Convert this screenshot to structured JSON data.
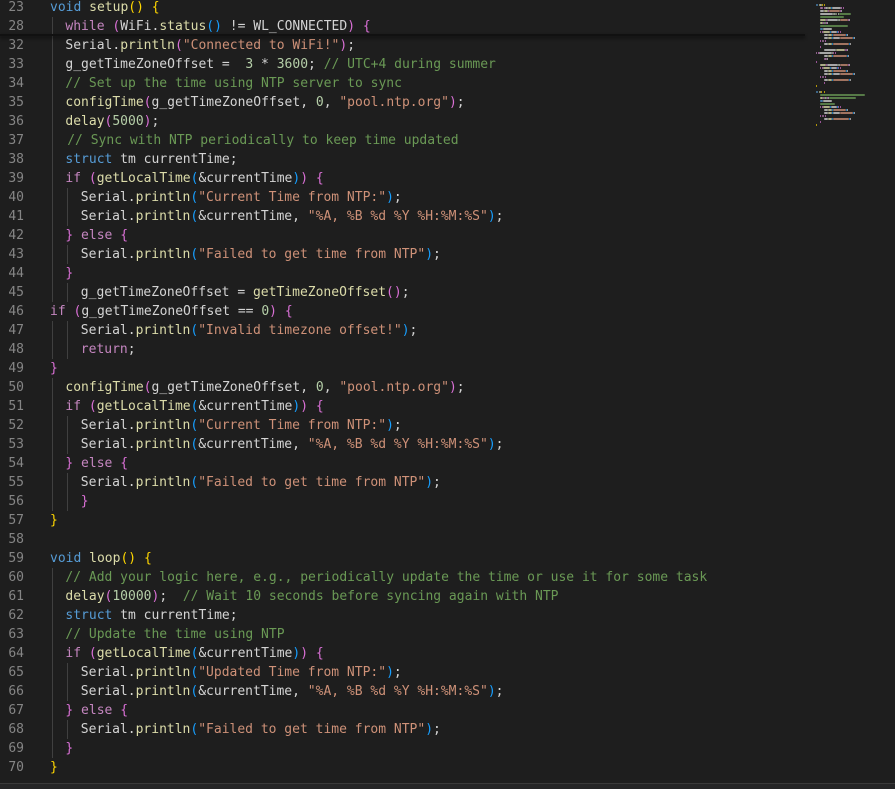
{
  "colors": {
    "background": "#1e1e1e",
    "line_number": "#858585",
    "keyword": "#569cd6",
    "control": "#c586c0",
    "function": "#dcdcaa",
    "string": "#ce9178",
    "number": "#b5cea8",
    "comment": "#6a9955",
    "plain": "#d4d4d4",
    "bracket_1": "#ffd700",
    "bracket_2": "#da70d6",
    "bracket_3": "#179fff"
  },
  "editor": {
    "lines": [
      {
        "n": "23",
        "indent": 0,
        "tokens": [
          [
            "kw",
            "void"
          ],
          [
            "plain",
            " "
          ],
          [
            "fn",
            "setup"
          ],
          [
            "br1",
            "()"
          ],
          [
            "plain",
            " "
          ],
          [
            "br1",
            "{"
          ]
        ]
      },
      {
        "n": "28",
        "indent": 1,
        "tokens": [
          [
            "ctrl",
            "while"
          ],
          [
            "plain",
            " "
          ],
          [
            "br2",
            "("
          ],
          [
            "plain",
            "WiFi."
          ],
          [
            "fn",
            "status"
          ],
          [
            "br3",
            "()"
          ],
          [
            "plain",
            " != WL_CONNECTED"
          ],
          [
            "br2",
            ")"
          ],
          [
            "plain",
            " "
          ],
          [
            "br2",
            "{"
          ]
        ]
      },
      {
        "n": "32",
        "indent": 1,
        "tokens": [
          [
            "plain",
            "Serial."
          ],
          [
            "fn",
            "println"
          ],
          [
            "br2",
            "("
          ],
          [
            "str",
            "\"Connected to WiFi!\""
          ],
          [
            "br2",
            ")"
          ],
          [
            "plain",
            ";"
          ]
        ]
      },
      {
        "n": "33",
        "indent": 1,
        "tokens": [
          [
            "plain",
            "g_getTimeZoneOffset =  "
          ],
          [
            "num",
            "3"
          ],
          [
            "plain",
            " * "
          ],
          [
            "num",
            "3600"
          ],
          [
            "plain",
            "; "
          ],
          [
            "cm",
            "// UTC+4 during summer"
          ]
        ]
      },
      {
        "n": "34",
        "indent": 1,
        "tokens": [
          [
            "cm",
            "// Set up the time using NTP server to sync"
          ]
        ]
      },
      {
        "n": "35",
        "indent": 1,
        "tokens": [
          [
            "fn",
            "configTime"
          ],
          [
            "br2",
            "("
          ],
          [
            "plain",
            "g_getTimeZoneOffset, "
          ],
          [
            "num",
            "0"
          ],
          [
            "plain",
            ", "
          ],
          [
            "str",
            "\"pool.ntp.org\""
          ],
          [
            "br2",
            ")"
          ],
          [
            "plain",
            ";"
          ]
        ]
      },
      {
        "n": "36",
        "indent": 1,
        "tokens": [
          [
            "fn",
            "delay"
          ],
          [
            "br2",
            "("
          ],
          [
            "num",
            "5000"
          ],
          [
            "br2",
            ")"
          ],
          [
            "plain",
            ";"
          ]
        ]
      },
      {
        "n": "37",
        "indent": 1.12,
        "tokens": [
          [
            "cm",
            "// Sync with NTP periodically to keep time updated"
          ]
        ]
      },
      {
        "n": "38",
        "indent": 1,
        "tokens": [
          [
            "kw",
            "struct"
          ],
          [
            "plain",
            " tm currentTime;"
          ]
        ]
      },
      {
        "n": "39",
        "indent": 1,
        "tokens": [
          [
            "ctrl",
            "if"
          ],
          [
            "plain",
            " "
          ],
          [
            "br2",
            "("
          ],
          [
            "fn",
            "getLocalTime"
          ],
          [
            "br3",
            "("
          ],
          [
            "plain",
            "&currentTime"
          ],
          [
            "br3",
            ")"
          ],
          [
            "br2",
            ")"
          ],
          [
            "plain",
            " "
          ],
          [
            "br2",
            "{"
          ]
        ]
      },
      {
        "n": "40",
        "indent": 2,
        "tokens": [
          [
            "plain",
            "Serial."
          ],
          [
            "fn",
            "println"
          ],
          [
            "br3",
            "("
          ],
          [
            "str",
            "\"Current Time from NTP:\""
          ],
          [
            "br3",
            ")"
          ],
          [
            "plain",
            ";"
          ]
        ]
      },
      {
        "n": "41",
        "indent": 2,
        "tokens": [
          [
            "plain",
            "Serial."
          ],
          [
            "fn",
            "println"
          ],
          [
            "br3",
            "("
          ],
          [
            "plain",
            "&currentTime, "
          ],
          [
            "str",
            "\"%A, %B %d %Y %H:%M:%S\""
          ],
          [
            "br3",
            ")"
          ],
          [
            "plain",
            ";"
          ]
        ]
      },
      {
        "n": "42",
        "indent": 1,
        "tokens": [
          [
            "br2",
            "}"
          ],
          [
            "plain",
            " "
          ],
          [
            "ctrl",
            "else"
          ],
          [
            "plain",
            " "
          ],
          [
            "br2",
            "{"
          ]
        ]
      },
      {
        "n": "43",
        "indent": 2,
        "tokens": [
          [
            "plain",
            "Serial."
          ],
          [
            "fn",
            "println"
          ],
          [
            "br3",
            "("
          ],
          [
            "str",
            "\"Failed to get time from NTP\""
          ],
          [
            "br3",
            ")"
          ],
          [
            "plain",
            ";"
          ]
        ]
      },
      {
        "n": "44",
        "indent": 1,
        "tokens": [
          [
            "br2",
            "}"
          ]
        ]
      },
      {
        "n": "45",
        "indent": 2,
        "tokens": [
          [
            "plain",
            "g_getTimeZoneOffset = "
          ],
          [
            "fn",
            "getTimeZoneOffset"
          ],
          [
            "br2",
            "()"
          ],
          [
            "plain",
            ";"
          ]
        ]
      },
      {
        "n": "46",
        "indent": 0,
        "tokens": [
          [
            "ctrl",
            "if"
          ],
          [
            "plain",
            " "
          ],
          [
            "br2",
            "("
          ],
          [
            "plain",
            "g_getTimeZoneOffset == "
          ],
          [
            "num",
            "0"
          ],
          [
            "br2",
            ")"
          ],
          [
            "plain",
            " "
          ],
          [
            "br2",
            "{"
          ]
        ]
      },
      {
        "n": "47",
        "indent": 2,
        "tokens": [
          [
            "plain",
            "Serial."
          ],
          [
            "fn",
            "println"
          ],
          [
            "br3",
            "("
          ],
          [
            "str",
            "\"Invalid timezone offset!\""
          ],
          [
            "br3",
            ")"
          ],
          [
            "plain",
            ";"
          ]
        ]
      },
      {
        "n": "48",
        "indent": 2,
        "tokens": [
          [
            "ctrl",
            "return"
          ],
          [
            "plain",
            ";"
          ]
        ]
      },
      {
        "n": "49",
        "indent": 0,
        "tokens": [
          [
            "br2",
            "}"
          ]
        ]
      },
      {
        "n": "50",
        "indent": 1,
        "tokens": [
          [
            "fn",
            "configTime"
          ],
          [
            "br2",
            "("
          ],
          [
            "plain",
            "g_getTimeZoneOffset, "
          ],
          [
            "num",
            "0"
          ],
          [
            "plain",
            ", "
          ],
          [
            "str",
            "\"pool.ntp.org\""
          ],
          [
            "br2",
            ")"
          ],
          [
            "plain",
            ";"
          ]
        ]
      },
      {
        "n": "51",
        "indent": 1,
        "tokens": [
          [
            "ctrl",
            "if"
          ],
          [
            "plain",
            " "
          ],
          [
            "br2",
            "("
          ],
          [
            "fn",
            "getLocalTime"
          ],
          [
            "br3",
            "("
          ],
          [
            "plain",
            "&currentTime"
          ],
          [
            "br3",
            ")"
          ],
          [
            "br2",
            ")"
          ],
          [
            "plain",
            " "
          ],
          [
            "br2",
            "{"
          ]
        ]
      },
      {
        "n": "52",
        "indent": 2,
        "tokens": [
          [
            "plain",
            "Serial."
          ],
          [
            "fn",
            "println"
          ],
          [
            "br3",
            "("
          ],
          [
            "str",
            "\"Current Time from NTP:\""
          ],
          [
            "br3",
            ")"
          ],
          [
            "plain",
            ";"
          ]
        ]
      },
      {
        "n": "53",
        "indent": 2,
        "tokens": [
          [
            "plain",
            "Serial."
          ],
          [
            "fn",
            "println"
          ],
          [
            "br3",
            "("
          ],
          [
            "plain",
            "&currentTime, "
          ],
          [
            "str",
            "\"%A, %B %d %Y %H:%M:%S\""
          ],
          [
            "br3",
            ")"
          ],
          [
            "plain",
            ";"
          ]
        ]
      },
      {
        "n": "54",
        "indent": 1,
        "tokens": [
          [
            "br2",
            "}"
          ],
          [
            "plain",
            " "
          ],
          [
            "ctrl",
            "else"
          ],
          [
            "plain",
            " "
          ],
          [
            "br2",
            "{"
          ]
        ]
      },
      {
        "n": "55",
        "indent": 2,
        "tokens": [
          [
            "plain",
            "Serial."
          ],
          [
            "fn",
            "println"
          ],
          [
            "br3",
            "("
          ],
          [
            "str",
            "\"Failed to get time from NTP\""
          ],
          [
            "br3",
            ")"
          ],
          [
            "plain",
            ";"
          ]
        ]
      },
      {
        "n": "56",
        "indent": 2,
        "tokens": [
          [
            "br2",
            "}"
          ]
        ]
      },
      {
        "n": "57",
        "indent": 0,
        "tokens": [
          [
            "br1",
            "}"
          ]
        ]
      },
      {
        "n": "58",
        "indent": 0,
        "tokens": []
      },
      {
        "n": "59",
        "indent": 0,
        "tokens": [
          [
            "kw",
            "void"
          ],
          [
            "plain",
            " "
          ],
          [
            "fn",
            "loop"
          ],
          [
            "br1",
            "()"
          ],
          [
            "plain",
            " "
          ],
          [
            "br1",
            "{"
          ]
        ]
      },
      {
        "n": "60",
        "indent": 1,
        "tokens": [
          [
            "cm",
            "// Add your logic here, e.g., periodically update the time or use it for some task"
          ]
        ]
      },
      {
        "n": "61",
        "indent": 1,
        "tokens": [
          [
            "fn",
            "delay"
          ],
          [
            "br2",
            "("
          ],
          [
            "num",
            "10000"
          ],
          [
            "br2",
            ")"
          ],
          [
            "plain",
            ";  "
          ],
          [
            "cm",
            "// Wait 10 seconds before syncing again with NTP"
          ]
        ]
      },
      {
        "n": "62",
        "indent": 1,
        "tokens": [
          [
            "kw",
            "struct"
          ],
          [
            "plain",
            " tm currentTime;"
          ]
        ]
      },
      {
        "n": "63",
        "indent": 1,
        "tokens": [
          [
            "cm",
            "// Update the time using NTP"
          ]
        ]
      },
      {
        "n": "64",
        "indent": 1,
        "tokens": [
          [
            "ctrl",
            "if"
          ],
          [
            "plain",
            " "
          ],
          [
            "br2",
            "("
          ],
          [
            "fn",
            "getLocalTime"
          ],
          [
            "br3",
            "("
          ],
          [
            "plain",
            "&currentTime"
          ],
          [
            "br3",
            ")"
          ],
          [
            "br2",
            ")"
          ],
          [
            "plain",
            " "
          ],
          [
            "br2",
            "{"
          ]
        ]
      },
      {
        "n": "65",
        "indent": 2,
        "tokens": [
          [
            "plain",
            "Serial."
          ],
          [
            "fn",
            "println"
          ],
          [
            "br3",
            "("
          ],
          [
            "str",
            "\"Updated Time from NTP:\""
          ],
          [
            "br3",
            ")"
          ],
          [
            "plain",
            ";"
          ]
        ]
      },
      {
        "n": "66",
        "indent": 2,
        "tokens": [
          [
            "plain",
            "Serial."
          ],
          [
            "fn",
            "println"
          ],
          [
            "br3",
            "("
          ],
          [
            "plain",
            "&currentTime, "
          ],
          [
            "str",
            "\"%A, %B %d %Y %H:%M:%S\""
          ],
          [
            "br3",
            ")"
          ],
          [
            "plain",
            ";"
          ]
        ]
      },
      {
        "n": "67",
        "indent": 1,
        "tokens": [
          [
            "br2",
            "}"
          ],
          [
            "plain",
            " "
          ],
          [
            "ctrl",
            "else"
          ],
          [
            "plain",
            " "
          ],
          [
            "br2",
            "{"
          ]
        ]
      },
      {
        "n": "68",
        "indent": 2,
        "tokens": [
          [
            "plain",
            "Serial."
          ],
          [
            "fn",
            "println"
          ],
          [
            "br3",
            "("
          ],
          [
            "str",
            "\"Failed to get time from NTP\""
          ],
          [
            "br3",
            ")"
          ],
          [
            "plain",
            ";"
          ]
        ]
      },
      {
        "n": "69",
        "indent": 1,
        "tokens": [
          [
            "br2",
            "}"
          ]
        ]
      },
      {
        "n": "70",
        "indent": 0,
        "tokens": [
          [
            "br1",
            "}"
          ]
        ]
      }
    ]
  }
}
